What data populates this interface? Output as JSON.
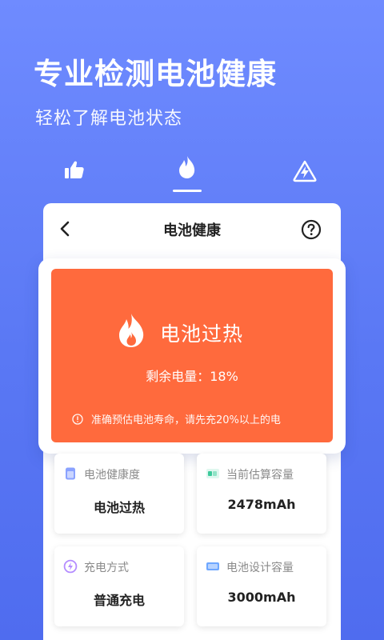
{
  "hero": {
    "title": "专业检测电池健康",
    "subtitle": "轻松了解电池状态"
  },
  "tabs": [
    {
      "icon": "thumbs-up-icon",
      "active": false
    },
    {
      "icon": "flame-icon",
      "active": true
    },
    {
      "icon": "lightning-bolt-icon",
      "active": false
    }
  ],
  "panel": {
    "title": "电池健康",
    "back_icon": "chevron-left-icon",
    "help_icon": "question-circle-icon"
  },
  "status": {
    "title": "电池过热",
    "remaining": "剩余电量：18%",
    "tip": "准确预估电池寿命，请先充20%以上的电",
    "color": "#ff6a3d"
  },
  "cards": [
    {
      "label": "电池健康度",
      "value": "电池过热",
      "icon": "battery-card-icon"
    },
    {
      "label": "当前估算容量",
      "value": "2478mAh",
      "icon": "battery-capacity-icon"
    },
    {
      "label": "充电方式",
      "value": "普通充电",
      "icon": "charge-mode-icon"
    },
    {
      "label": "电池设计容量",
      "value": "3000mAh",
      "icon": "battery-design-icon"
    }
  ],
  "colors": {
    "background_top": "#6f8bff",
    "background_bottom": "#4f6cef",
    "accent_orange": "#ff6a3d"
  }
}
